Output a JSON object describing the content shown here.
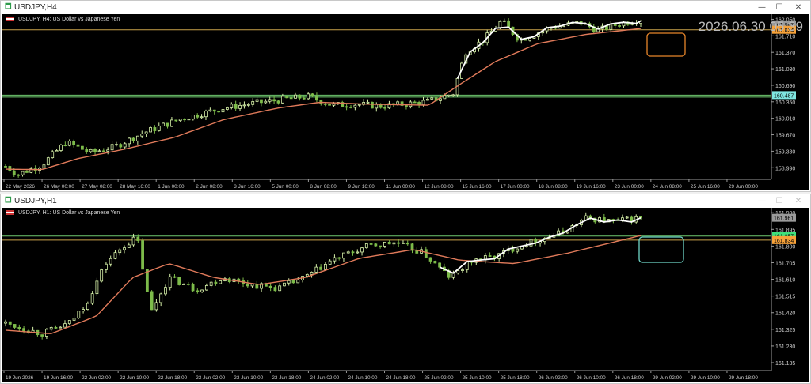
{
  "colors": {
    "bull": "#d6f0a8",
    "bear": "#7dbb4a",
    "ma": "#e07a5a",
    "zigzag": "#ffffff",
    "gridline_h": "#c9a24a",
    "gridline_green": "#6fc96f",
    "badge_orange": "#f7a23a",
    "badge_green": "#3fe07a",
    "badge_cyan": "#7fe6e0",
    "box_orange": "#e8862a",
    "box_cyan": "#6fd6c8",
    "axis_text": "#cfcfcf",
    "background": "#000000"
  },
  "windows": [
    {
      "id": "h4",
      "title": "USDJPY,H4",
      "icon": "chart-window-icon",
      "symbol_label": "USDJPY, H4: US Dollar vs Japanese Yen",
      "overlay_datetime": "2026.06.30 05:39",
      "buttons": {
        "minimize": "—",
        "maximize": "☐",
        "close": "✕"
      },
      "y_axis": {
        "min": 158.75,
        "max": 162.09,
        "ticks": [
          "162.050",
          "161.710",
          "161.370",
          "161.030",
          "160.690",
          "160.350",
          "160.010",
          "159.670",
          "159.330",
          "158.990"
        ]
      },
      "price_badges": [
        {
          "text": "161.947",
          "value": 161.947,
          "color": "#9a9a9a",
          "text_color": "#000000"
        },
        {
          "text": "161.834",
          "value": 161.834,
          "color": "#f7a23a",
          "text_color": "#000000"
        },
        {
          "text": "160.487",
          "value": 160.487,
          "color": "#7fe6e0",
          "text_color": "#000000"
        }
      ],
      "horizontal_lines": [
        {
          "value": 161.834,
          "color": "#c9a24a"
        },
        {
          "value": 160.487,
          "color": "#6fc96f"
        },
        {
          "value": 160.447,
          "color": "#6fc96f"
        }
      ],
      "x_labels": [
        "22 May 2026",
        "26 May 00:00",
        "27 May 08:00",
        "28 May 16:00",
        "1 Jun 00:00",
        "2 Jun 08:00",
        "3 Jun 16:00",
        "5 Jun 00:00",
        "8 Jun 08:00",
        "9 Jun 16:00",
        "11 Jun 00:00",
        "12 Jun 08:00",
        "15 Jun 16:00",
        "17 Jun 00:00",
        "18 Jun 08:00",
        "19 Jun 16:00",
        "23 Jun 00:00",
        "24 Jun 08:00",
        "25 Jun 16:00",
        "29 Jun 00:00"
      ],
      "chart_data": {
        "type": "candlestick",
        "candle_count": 150,
        "anchors": [
          [
            0,
            159.02
          ],
          [
            4,
            158.85
          ],
          [
            12,
            159.05
          ],
          [
            20,
            159.52
          ],
          [
            28,
            159.3
          ],
          [
            36,
            159.42
          ],
          [
            46,
            159.72
          ],
          [
            58,
            160.0
          ],
          [
            72,
            160.22
          ],
          [
            82,
            160.32
          ],
          [
            92,
            160.4
          ],
          [
            100,
            160.46
          ],
          [
            108,
            160.28
          ],
          [
            116,
            160.3
          ],
          [
            124,
            160.26
          ],
          [
            132,
            160.3
          ],
          [
            140,
            160.36
          ],
          [
            148,
            160.52
          ],
          [
            152,
            161.38
          ],
          [
            158,
            161.62
          ],
          [
            164,
            162.02
          ],
          [
            170,
            161.62
          ],
          [
            180,
            161.88
          ],
          [
            190,
            161.98
          ],
          [
            196,
            161.82
          ],
          [
            203,
            161.96
          ],
          [
            210,
            162.05
          ]
        ],
        "ma_anchors": [
          [
            0,
            158.96
          ],
          [
            12,
            158.95
          ],
          [
            24,
            159.18
          ],
          [
            40,
            159.38
          ],
          [
            56,
            159.62
          ],
          [
            72,
            159.98
          ],
          [
            90,
            160.22
          ],
          [
            104,
            160.34
          ],
          [
            120,
            160.3
          ],
          [
            140,
            160.28
          ],
          [
            150,
            160.7
          ],
          [
            162,
            161.18
          ],
          [
            176,
            161.55
          ],
          [
            192,
            161.74
          ],
          [
            210,
            161.86
          ]
        ],
        "zigzag_from_index": 150,
        "seed": 7
      },
      "annotations": [
        {
          "type": "rectangle",
          "color": "#e8862a"
        }
      ]
    },
    {
      "id": "h1",
      "title": "USDJPY,H1",
      "icon": "chart-window-icon",
      "symbol_label": "USDJPY, H1: US Dollar vs Japanese Yen",
      "buttons": {
        "minimize": "—",
        "maximize": "☐",
        "close": "✕"
      },
      "y_axis": {
        "min": 161.09,
        "max": 162.0,
        "ticks": [
          "161.990",
          "161.895",
          "161.800",
          "161.705",
          "161.610",
          "161.515",
          "161.420",
          "161.325",
          "161.230",
          "161.135"
        ]
      },
      "price_badges": [
        {
          "text": "161.961",
          "value": 161.961,
          "color": "#9a9a9a",
          "text_color": "#000000"
        },
        {
          "text": "161.857",
          "value": 161.857,
          "color": "#3fe07a",
          "text_color": "#000000"
        },
        {
          "text": "161.834",
          "value": 161.834,
          "color": "#f7a23a",
          "text_color": "#000000"
        }
      ],
      "horizontal_lines": [
        {
          "value": 161.857,
          "color": "#6fc96f"
        },
        {
          "value": 161.834,
          "color": "#c9a24a"
        }
      ],
      "x_labels": [
        "19 Jun 2026",
        "19 Jun 16:00",
        "22 Jun 02:00",
        "22 Jun 10:00",
        "22 Jun 18:00",
        "23 Jun 02:00",
        "23 Jun 10:00",
        "23 Jun 18:00",
        "24 Jun 02:00",
        "24 Jun 10:00",
        "24 Jun 18:00",
        "25 Jun 02:00",
        "25 Jun 10:00",
        "25 Jun 18:00",
        "26 Jun 02:00",
        "26 Jun 10:00",
        "26 Jun 18:00",
        "29 Jun 02:00",
        "29 Jun 10:00",
        "29 Jun 18:00"
      ],
      "chart_data": {
        "type": "candlestick",
        "candle_count": 140,
        "anchors": [
          [
            0,
            161.36
          ],
          [
            8,
            161.3
          ],
          [
            14,
            161.36
          ],
          [
            18,
            161.48
          ],
          [
            22,
            161.7
          ],
          [
            26,
            161.8
          ],
          [
            29,
            161.85
          ],
          [
            32,
            161.42
          ],
          [
            36,
            161.62
          ],
          [
            42,
            161.55
          ],
          [
            48,
            161.62
          ],
          [
            54,
            161.58
          ],
          [
            60,
            161.56
          ],
          [
            66,
            161.62
          ],
          [
            72,
            161.72
          ],
          [
            80,
            161.8
          ],
          [
            86,
            161.82
          ],
          [
            92,
            161.76
          ],
          [
            98,
            161.62
          ],
          [
            103,
            161.72
          ],
          [
            108,
            161.74
          ],
          [
            113,
            161.8
          ],
          [
            118,
            161.84
          ],
          [
            123,
            161.88
          ],
          [
            128,
            161.96
          ],
          [
            134,
            161.94
          ],
          [
            140,
            161.96
          ]
        ],
        "ma_anchors": [
          [
            0,
            161.32
          ],
          [
            10,
            161.3
          ],
          [
            20,
            161.4
          ],
          [
            28,
            161.62
          ],
          [
            36,
            161.7
          ],
          [
            46,
            161.62
          ],
          [
            56,
            161.58
          ],
          [
            66,
            161.62
          ],
          [
            78,
            161.73
          ],
          [
            90,
            161.78
          ],
          [
            100,
            161.72
          ],
          [
            112,
            161.7
          ],
          [
            124,
            161.76
          ],
          [
            140,
            161.86
          ]
        ],
        "zigzag_from_index": 96,
        "seed": 13
      },
      "annotations": [
        {
          "type": "rectangle",
          "color": "#6fd6c8"
        }
      ]
    }
  ]
}
